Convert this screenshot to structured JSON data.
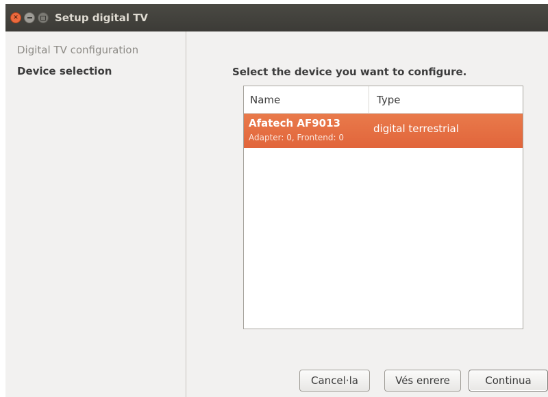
{
  "window": {
    "title": "Setup digital TV",
    "controls": {
      "close_icon": "close-icon",
      "minimize_icon": "minimize-icon",
      "maximize_icon": "maximize-icon"
    }
  },
  "sidebar": {
    "items": [
      {
        "label": "Digital TV configuration",
        "state": "inactive"
      },
      {
        "label": "Device selection",
        "state": "active"
      }
    ]
  },
  "main": {
    "heading": "Select the device you want to configure.",
    "table": {
      "columns": [
        "Name",
        "Type"
      ],
      "rows": [
        {
          "name": "Afatech AF9013",
          "detail": "Adapter: 0, Frontend: 0",
          "type": "digital terrestrial",
          "selected": true
        }
      ]
    }
  },
  "buttons": {
    "cancel": "Cancel·la",
    "back": "Vés enrere",
    "next": "Continua"
  },
  "colors": {
    "titlebar": "#3c3b37",
    "selection": "#e5693d",
    "close_button": "#ec6a3e"
  }
}
